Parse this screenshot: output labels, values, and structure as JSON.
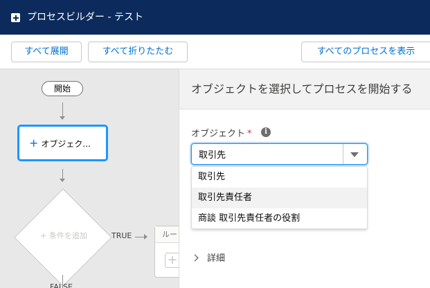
{
  "window": {
    "title": "プロセスビルダー - テスト"
  },
  "toolbar": {
    "expand_all": "すべて展開",
    "collapse_all": "すべて折りたたむ",
    "view_all": "すべてのプロセスを表示"
  },
  "canvas": {
    "start_label": "開始",
    "object_node_label": "オブジェク...",
    "criteria_label": "条件を追加",
    "true_label": "TRUE",
    "false_label": "FALSE",
    "rule_label": "ルー"
  },
  "panel": {
    "heading": "オブジェクトを選択してプロセスを開始する",
    "object_label": "オブジェクト",
    "required_mark": "*",
    "info_glyph": "i",
    "object_value": "取引先",
    "options": [
      "取引先",
      "取引先責任者",
      "商談 取引先責任者の役割"
    ],
    "details_label": "詳細"
  }
}
